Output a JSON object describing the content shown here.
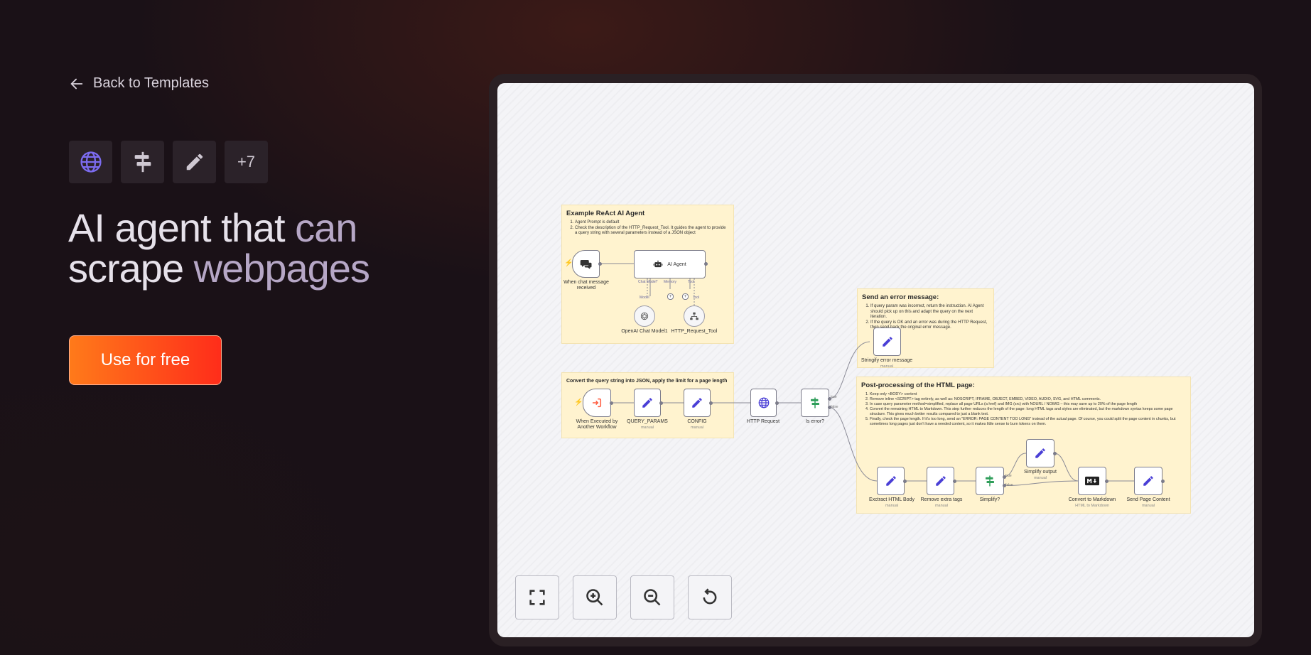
{
  "back": {
    "label": "Back to Templates"
  },
  "tags": {
    "icons": [
      "globe-icon",
      "signpost-icon",
      "pencil-icon"
    ],
    "more": "+7"
  },
  "hero": {
    "title_a": "AI agent that ",
    "title_b": "can",
    "title_c": "scrape ",
    "title_d": "webpages"
  },
  "cta": {
    "label": "Use for free"
  },
  "workflow": {
    "sticky_agent": {
      "title": "Example ReAct AI Agent",
      "items": [
        "Agent Prompt is default",
        "Check the description of the HTTP_Request_Tool. It guides the agent to provide a query string with several parameters instead of a JSON object"
      ]
    },
    "sticky_convert": {
      "title": "Convert the query string into JSON, apply the limit for a page length"
    },
    "sticky_error": {
      "title": "Send an error message:",
      "items": [
        "If query param was incorrect, return the instruction. AI Agent should pick up on this and adapt the query on the next iteration.",
        "If the query is OK and an error was during the HTTP Request, then send back the original error message."
      ]
    },
    "sticky_post": {
      "title": "Post-processing of the HTML page:",
      "items": [
        "Keep only <BODY> content",
        "Remove inline <SCRIPT> tag entirely, as well as: NOSCRIPT, IFRAME, OBJECT, EMBED, VIDEO, AUDIO, SVG, and HTML comments.",
        "In case query parameter method=simplified, replace all page URLs (a href) and IMG (src) with NOURL / NOIMG – this may save up to 20% of the page length",
        "Convert the remaining HTML to Markdown. This step further reduces the length of the page: long HTML tags and styles are eliminated, but the markdown syntax keeps some page structure. This gives much better results compared to just a blank text.",
        "Finally, check the page length. If it's too long, send an \"ERROR: PAGE CONTENT TOO LONG\" instead of the actual page. Of course, you could split the page content in chunks, but sometimes long pages just don't have a needed content, so it makes little sense to burn tokens on them."
      ]
    },
    "nodes": {
      "chat_trigger": "When chat message received",
      "ai_agent": "AI Agent",
      "chat_model_edge": "Chat Model*",
      "memory_edge": "Memory",
      "tool_edge": "Tool",
      "model_edge": "Model",
      "tool_edge2": "Tool",
      "openai": "OpenAI Chat Model1",
      "http_tool": "HTTP_Request_Tool",
      "exec_trigger": "When Executed by Another Workflow",
      "query_params": "QUERY_PARAMS",
      "query_params_sub": "manual",
      "config": "CONFIG",
      "config_sub": "manual",
      "http_request": "HTTP Request",
      "is_error": "Is error?",
      "true_label": "true",
      "false_label": "false",
      "stringify": "Stringify error message",
      "stringify_sub": "manual",
      "extract": "Exctract HTML Body",
      "extract_sub": "manual",
      "remove_tags": "Remove extra tags",
      "remove_tags_sub": "manual",
      "simplify_q": "Simplify?",
      "simplify_out": "Simplify output",
      "simplify_out_sub": "manual",
      "to_markdown": "Convert to Markdown",
      "to_markdown_sub": "HTML to Markdown",
      "send_page": "Send Page Content",
      "send_page_sub": "manual",
      "true2": "true",
      "false2": "false"
    }
  },
  "controls": [
    "fit-view-icon",
    "zoom-in-icon",
    "zoom-out-icon",
    "reset-icon"
  ],
  "colors": {
    "accent_orange": "#ff7a1a",
    "accent_red": "#ff2d1a",
    "node_blue": "#4a3fd6",
    "node_green": "#2f9e5a",
    "sticky": "#fff3cf"
  }
}
